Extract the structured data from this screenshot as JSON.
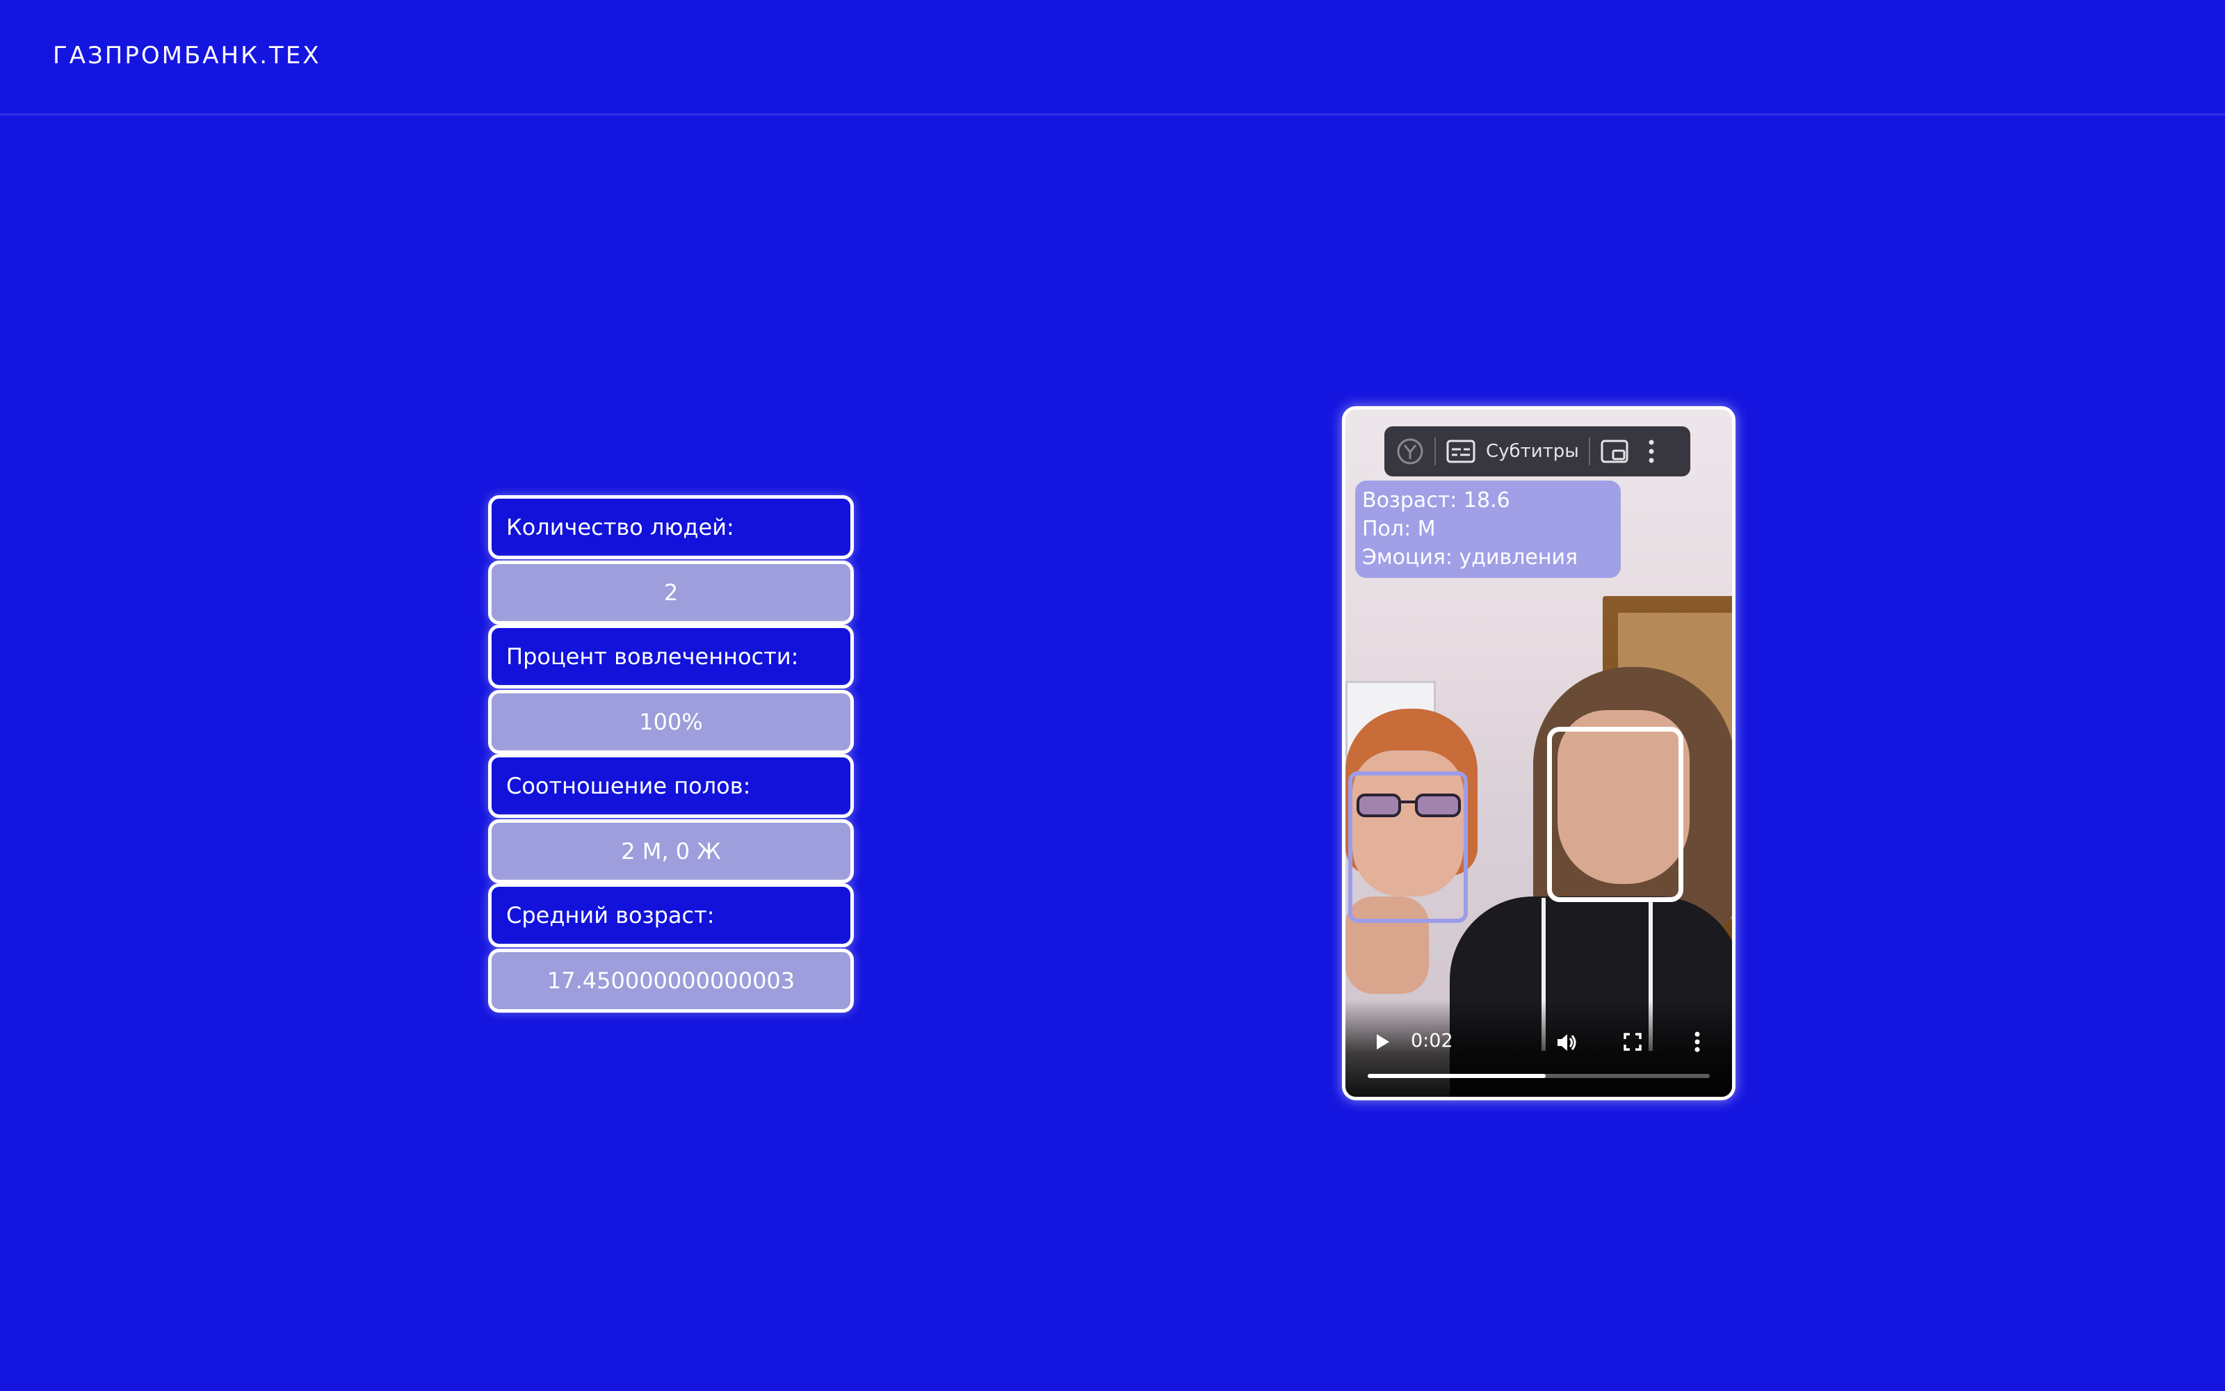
{
  "header": {
    "logo_text": "ГАЗПРОМБАНК.ТЕХ"
  },
  "stats": {
    "people_label": "Количество людей:",
    "people_value": "2",
    "engagement_label": "Процент вовлеченности:",
    "engagement_value": "100%",
    "gender_label": "Соотношение полов:",
    "gender_value": "2 М, 0 Ж",
    "age_label": "Средний возраст:",
    "age_value": "17.450000000000003"
  },
  "video": {
    "overlay": {
      "age": "Возраст: 18.6",
      "gender": "Пол: М",
      "emotion": "Эмоция: удивления"
    },
    "toolbar": {
      "subtitles_label": "Субтитры",
      "icons": [
        "yandex-icon",
        "subtitles-icon",
        "picture-in-picture-icon",
        "more-vertical-icon"
      ]
    },
    "controls": {
      "time": "0:02",
      "progress": 0.52,
      "icons": [
        "play-icon",
        "volume-icon",
        "fullscreen-icon",
        "more-vertical-icon"
      ]
    }
  },
  "colors": {
    "background": "#1515E0",
    "label_bg": "#1212DA",
    "value_bg": "#9D9EDB",
    "border": "#FFFFFF"
  }
}
